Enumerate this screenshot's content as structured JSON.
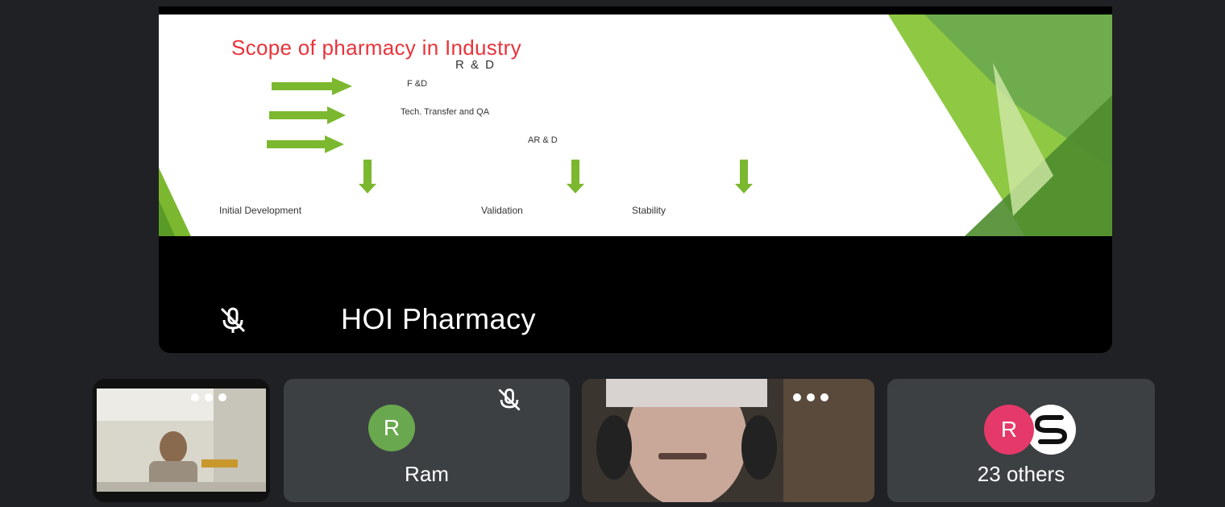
{
  "presentation": {
    "title": "Scope of pharmacy in Industry",
    "subtitle": "R & D",
    "items": [
      "F &D",
      "Tech. Transfer and QA",
      "AR & D"
    ],
    "outcomes": [
      "Initial Development",
      "Validation",
      "Stability"
    ]
  },
  "presenter": {
    "name": "HOI Pharmacy",
    "mic_icon": "mic-off-icon"
  },
  "participants": [
    {
      "type": "video",
      "label": ""
    },
    {
      "type": "avatar",
      "initial": "R",
      "name": "Ram",
      "avatar_color": "#6aa84f",
      "muted": true
    },
    {
      "type": "video",
      "label": ""
    },
    {
      "type": "group",
      "initial": "R",
      "name": "23 others",
      "avatar_color": "#e5396a"
    }
  ],
  "colors": {
    "background": "#202124",
    "slide_green": "#7cb82f",
    "title_red": "#e8333a"
  }
}
